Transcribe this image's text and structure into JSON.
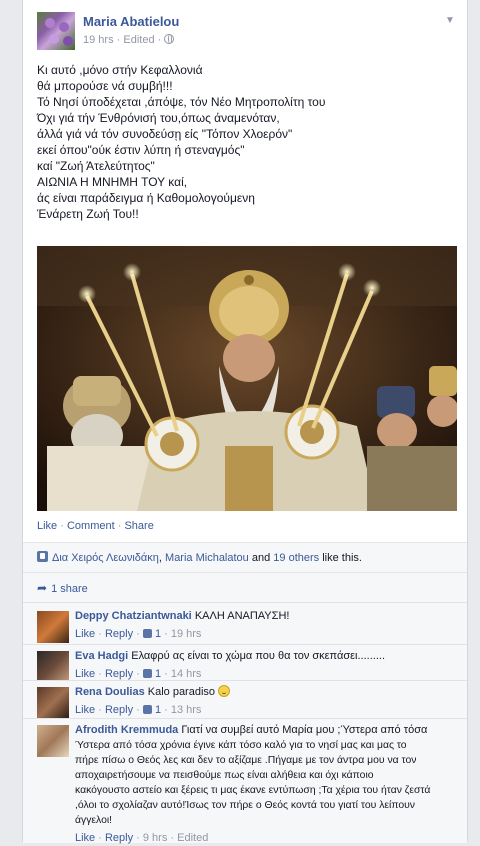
{
  "post": {
    "author": "Maria Abatielou",
    "time": "19 hrs",
    "edited": "Edited",
    "lines": [
      "Κι αυτό ,μόνο στήν Κεφαλλονιά",
      "θά μπορούσε νά συμβή!!!",
      "Τό Νησί ύποδέχεται ,άπόψε, τόν Νέο Μητροπολίτη του",
      "Όχι γιά τήν Ένθρόνισή του,όπως άναμενόταν,",
      "άλλά γιά νά τόν συνοδεύσῃ είς \"Τόπον Χλοερόν\"",
      "εκεί όπου\"ούκ έστιν λύπη ή στεναγμός\"",
      "καί \"Ζωή Άτελεύτητος\"",
      "ΑΙΩΝΙΑ Η ΜΝΗΜΗ ΤΟΥ καί,",
      "άς είναι παράδειγμα ή Καθομολογούμενη",
      "Ένάρετη Ζωή Του!!"
    ],
    "icons": {
      "options": "chevron-down-icon",
      "privacy": "globe-icon"
    }
  },
  "actions": {
    "like": "Like",
    "comment": "Comment",
    "share": "Share",
    "separator": "·"
  },
  "likes": {
    "person1": "Δια Χειρός Λεωνιδάκη",
    "sep1": ",",
    "person2": "Maria Michalatou",
    "and": "and",
    "others": "19 others",
    "suffix": "like this."
  },
  "shares": {
    "label": "1 share"
  },
  "comments": [
    {
      "author": "Deppy Chatziantwnaki",
      "text": "ΚΑΛΗ ΑΝΑΠΑΥΣΗ!",
      "like": "Like",
      "reply": "Reply",
      "likes": "1",
      "time": "19 hrs"
    },
    {
      "author": "Eva Hadgi",
      "text": "Ελαφρύ ας είναι το χώμα που θα τον σκεπάσει.........",
      "like": "Like",
      "reply": "Reply",
      "likes": "1",
      "time": "14 hrs"
    },
    {
      "author": "Rena Doulias",
      "text": "Kalo paradiso",
      "like": "Like",
      "reply": "Reply",
      "likes": "1",
      "time": "13 hrs"
    },
    {
      "author": "Afrodith Kremmuda",
      "lines": [
        "Γιατί να συμβεί αυτό Μαρία μου ;Ύστερα από τόσα",
        "Ύστερα από τόσα χρόνια έγινε κάπ τόσο καλό για το νησί μας και μας το",
        "πήρε πίσω ο Θεός λες και δεν το αξίζαμε .Πήγαμε με τον άντρα μου να τον",
        "αποχαιρετήσουμε να πεισθούμε πως είναι αλήθεια και όχι κάποιο",
        "κακόγουστο αστείο και ξέρεις τι μας έκανε εντύπωση ;Τα χέρια του ήταν ζεστά",
        ",όλοι το σχολίαζαν αυτό!Ίσως τον πήρε ο Θεός κοντά του γιατί του λείπουν",
        "άγγελοι!"
      ],
      "like": "Like",
      "reply": "Reply",
      "time": "9 hrs",
      "edited": "Edited"
    }
  ]
}
